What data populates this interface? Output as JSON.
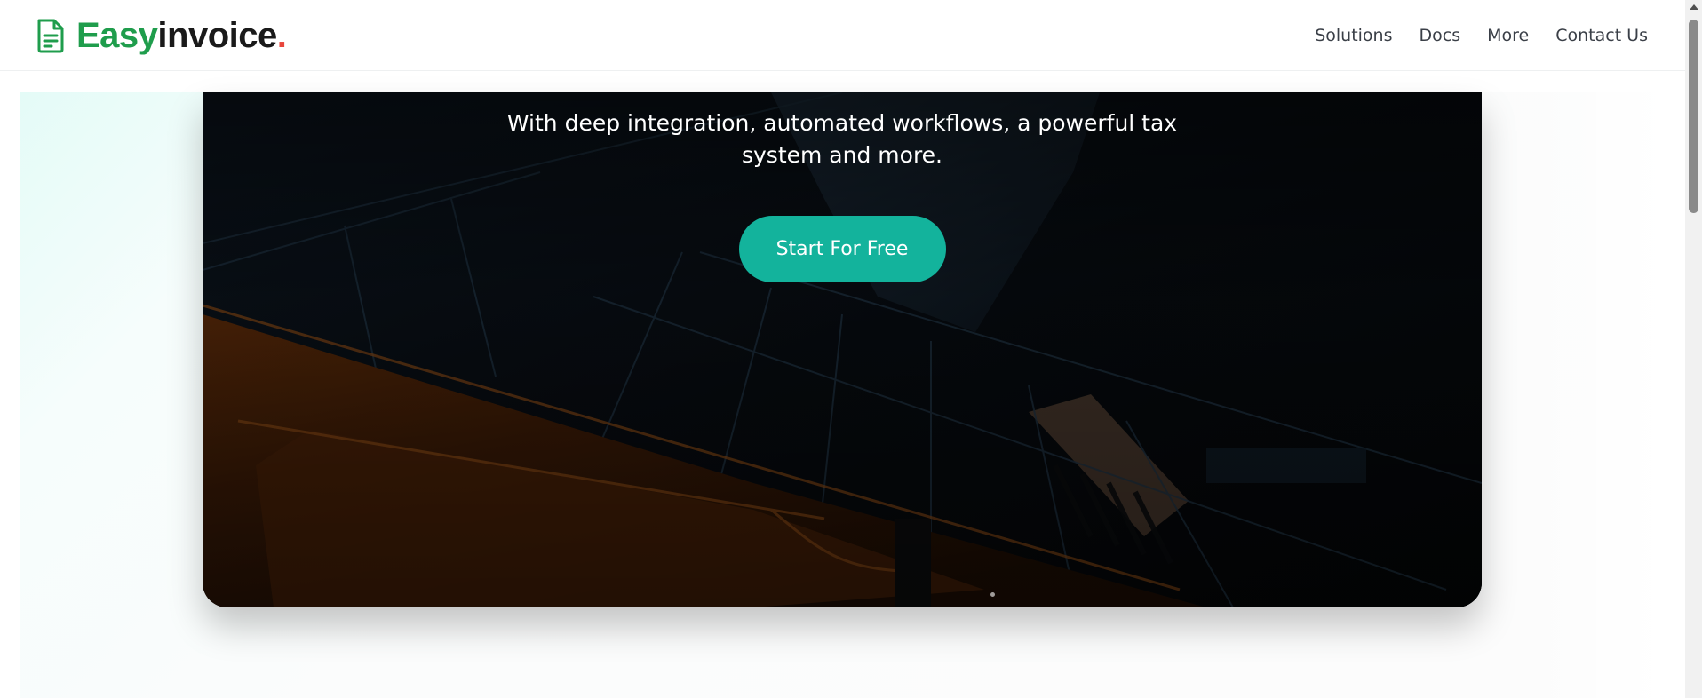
{
  "brand": {
    "part1": "Easy",
    "part2": "invoice",
    "dot": ".",
    "icon": "document-icon",
    "colors": {
      "easy": "#1f9d4c",
      "invoice": "#1a1a1a",
      "dot": "#e8453c"
    }
  },
  "nav": {
    "items": [
      {
        "label": "Solutions"
      },
      {
        "label": "Docs"
      },
      {
        "label": "More"
      },
      {
        "label": "Contact Us"
      }
    ]
  },
  "hero": {
    "subtitle": "With deep integration, automated workflows, a powerful tax system and more.",
    "cta_label": "Start For Free",
    "cta_color": "#13b39c"
  }
}
